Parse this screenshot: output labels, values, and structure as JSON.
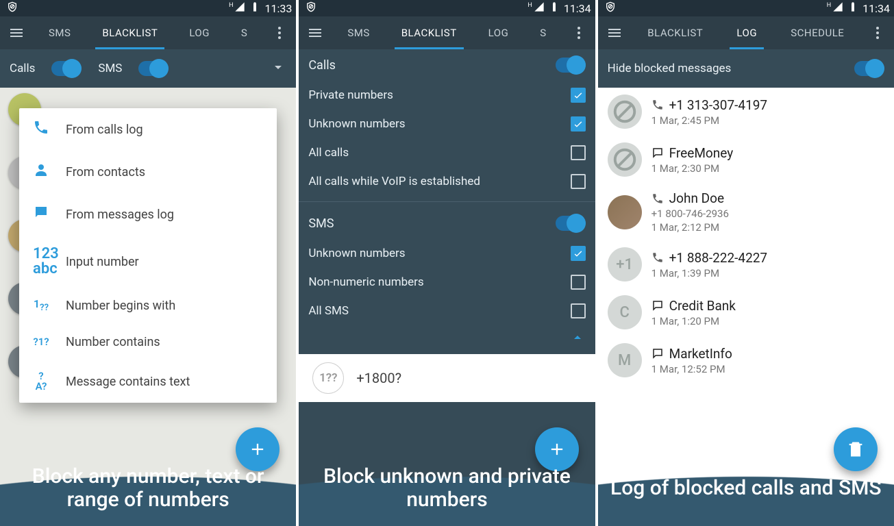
{
  "screen1": {
    "status": {
      "time": "11:33"
    },
    "tabs": [
      "SMS",
      "BLACKLIST",
      "LOG",
      "S"
    ],
    "active_tab": 1,
    "sub": {
      "calls": "Calls",
      "sms": "SMS"
    },
    "popup": [
      {
        "label": "From calls log",
        "icon": "phone"
      },
      {
        "label": "From contacts",
        "icon": "person"
      },
      {
        "label": "From messages log",
        "icon": "chat"
      },
      {
        "label": "Input number",
        "icon": "123abc"
      },
      {
        "label": "Number begins with",
        "icon": "1??"
      },
      {
        "label": "Number contains",
        "icon": "?1?"
      },
      {
        "label": "Message contains text",
        "icon": "?A?"
      }
    ],
    "caption": "Block any number, text or range of numbers"
  },
  "screen2": {
    "status": {
      "time": "11:34"
    },
    "tabs": [
      "SMS",
      "BLACKLIST",
      "LOG",
      "S"
    ],
    "active_tab": 1,
    "calls": {
      "title": "Calls",
      "items": [
        {
          "label": "Private numbers",
          "checked": true
        },
        {
          "label": "Unknown numbers",
          "checked": true
        },
        {
          "label": "All calls",
          "checked": false
        },
        {
          "label": "All calls while VoIP is established",
          "checked": false
        }
      ]
    },
    "sms": {
      "title": "SMS",
      "items": [
        {
          "label": "Unknown numbers",
          "checked": true
        },
        {
          "label": "Non-numeric numbers",
          "checked": false
        },
        {
          "label": "All SMS",
          "checked": false
        }
      ]
    },
    "rule": {
      "icon": "1??",
      "text": "+1800?"
    },
    "caption": "Block unknown and private numbers"
  },
  "screen3": {
    "status": {
      "time": "11:34"
    },
    "tabs": [
      "BLACKLIST",
      "LOG",
      "SCHEDULE"
    ],
    "active_tab": 1,
    "sub": {
      "label": "Hide blocked messages"
    },
    "log": [
      {
        "type": "call",
        "title": "+1 313-307-4197",
        "sub": "1 Mar, 2:45 PM",
        "avatar": "block"
      },
      {
        "type": "msg",
        "title": "FreeMoney",
        "sub": "1 Mar, 2:30 PM",
        "avatar": "block"
      },
      {
        "type": "call",
        "title": "John Doe",
        "num": "+1 800-746-2936",
        "sub": "1 Mar, 2:12 PM",
        "avatar": "img"
      },
      {
        "type": "call",
        "title": "+1 888-222-4227",
        "sub": "1 Mar, 1:39 PM",
        "avatar": "letter",
        "letter": "+1"
      },
      {
        "type": "msg",
        "title": "Credit Bank",
        "sub": "1 Mar, 1:20 PM",
        "avatar": "letter",
        "letter": "C"
      },
      {
        "type": "msg",
        "title": "MarketInfo",
        "sub": "1 Mar, 12:52 PM",
        "avatar": "letter",
        "letter": "M"
      }
    ],
    "caption": "Log of blocked calls and SMS"
  }
}
